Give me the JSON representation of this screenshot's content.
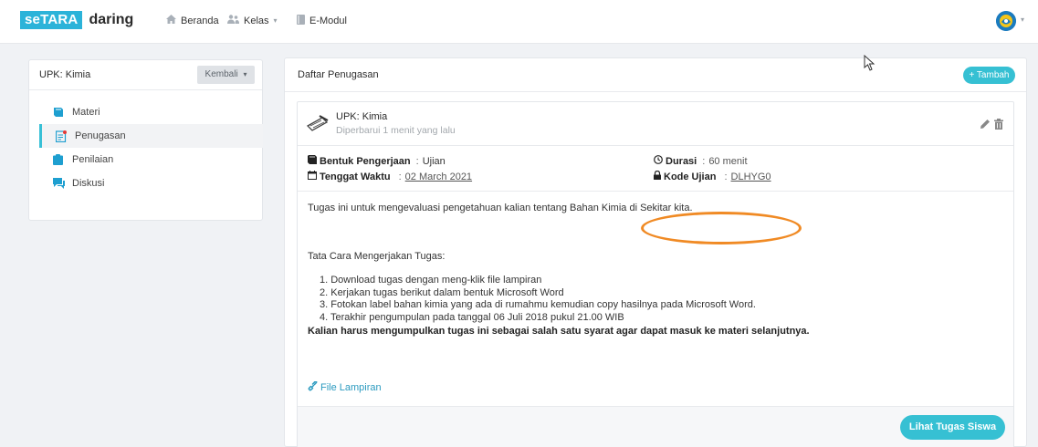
{
  "brand": {
    "part1": "seTARA",
    "part2": "daring"
  },
  "nav": {
    "beranda": "Beranda",
    "kelas": "Kelas",
    "emodul": "E-Modul"
  },
  "sidebar": {
    "title": "UPK: Kimia",
    "back_button": "Kembali",
    "items": [
      {
        "label": "Materi",
        "icon": "book-icon",
        "active": false
      },
      {
        "label": "Penugasan",
        "icon": "assignment-icon",
        "active": true
      },
      {
        "label": "Penilaian",
        "icon": "grade-icon",
        "active": false
      },
      {
        "label": "Diskusi",
        "icon": "chat-icon",
        "active": false
      }
    ]
  },
  "main": {
    "title": "Daftar Penugasan",
    "add_button": "+ Tambah",
    "task": {
      "name": "UPK: Kimia",
      "updated": "Diperbarui 1 menit yang lalu",
      "form_label": "Bentuk Pengerjaan",
      "form_value": "Ujian",
      "deadline_label": "Tenggat Waktu",
      "deadline_value": "02 March 2021",
      "duration_label": "Durasi",
      "duration_value": "60 menit",
      "code_label": "Kode Ujian",
      "code_value": "DLHYG0",
      "description": "Tugas ini untuk mengevaluasi pengetahuan kalian tentang Bahan Kimia di Sekitar kita.",
      "steps_title": "Tata Cara Mengerjakan Tugas:",
      "steps": [
        "1. Download tugas dengan meng-klik file lampiran",
        "2. Kerjakan tugas berikut dalam bentuk Microsoft Word",
        "3. Fotokan label bahan kimia yang ada di rumahmu kemudian copy hasilnya pada Microsoft Word.",
        "4. Terakhir pengumpulan pada tanggal 06 Juli 2018 pukul 21.00 WIB"
      ],
      "note": "Kalian harus mengumpulkan tugas ini sebagai salah satu syarat agar dapat masuk ke materi selanjutnya.",
      "attachment": "File Lampiran",
      "view_button": "Lihat Tugas Siswa"
    }
  },
  "colors": {
    "accent": "#36c0d3",
    "brand": "#2bb3d9",
    "highlight_oval": "#f08a24",
    "icon_blue": "#1e9fd0"
  }
}
